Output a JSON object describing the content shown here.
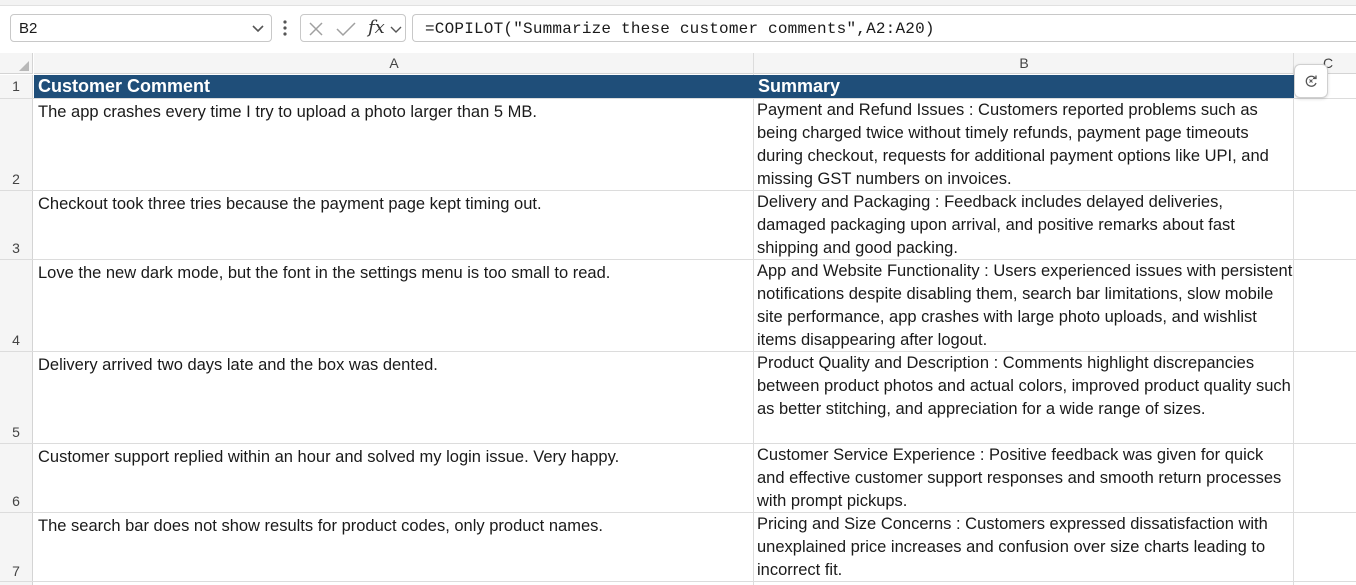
{
  "name_box": {
    "value": "B2"
  },
  "formula_bar": {
    "fx_label": "fx",
    "formula": "=COPILOT(\"Summarize these customer comments\",A2:A20)"
  },
  "columns": [
    "A",
    "B",
    "C"
  ],
  "rows": [
    "1",
    "2",
    "3",
    "4",
    "5",
    "6",
    "7"
  ],
  "headers": {
    "a": "Customer Comment",
    "b": "Summary"
  },
  "data_rows": [
    {
      "comment": "The app crashes every time I try to upload a photo larger than 5 MB.",
      "summary": "Payment and Refund Issues : Customers reported problems such as being charged twice without timely refunds, payment page timeouts during checkout, requests for additional payment options like UPI, and missing GST numbers on invoices."
    },
    {
      "comment": "Checkout took three tries because the payment page kept timing out.",
      "summary": "Delivery and Packaging : Feedback includes delayed deliveries, damaged packaging upon arrival, and positive remarks about fast shipping and good packing."
    },
    {
      "comment": "Love the new dark mode, but the font in the settings menu is too small to read.",
      "summary": "App and Website Functionality : Users experienced issues with persistent notifications despite disabling them, search bar limitations, slow mobile site performance, app crashes with large photo uploads, and wishlist items disappearing after logout."
    },
    {
      "comment": "Delivery arrived two days late and the box was dented.",
      "summary": "Product Quality and Description : Comments highlight discrepancies between product photos and actual colors, improved product quality such as better stitching, and appreciation for a wide range of sizes."
    },
    {
      "comment": "Customer support replied within an hour and solved my login issue. Very happy.",
      "summary": "Customer Service Experience : Positive feedback was given for quick and effective customer support responses and smooth return processes with prompt pickups."
    },
    {
      "comment": "The search bar does not show results for product codes, only product names.",
      "summary": "Pricing and Size Concerns : Customers expressed dissatisfaction with unexplained price increases and confusion over size charts leading to incorrect fit."
    }
  ],
  "colors": {
    "header_fill": "#1f4e79",
    "header_text": "#ffffff"
  },
  "icons": {
    "name_box_dropdown": "chevron-down-icon",
    "more": "more-vertical-icon",
    "cancel": "close-icon",
    "enter": "check-icon",
    "function": "function-icon",
    "refresh": "refresh-icon"
  }
}
